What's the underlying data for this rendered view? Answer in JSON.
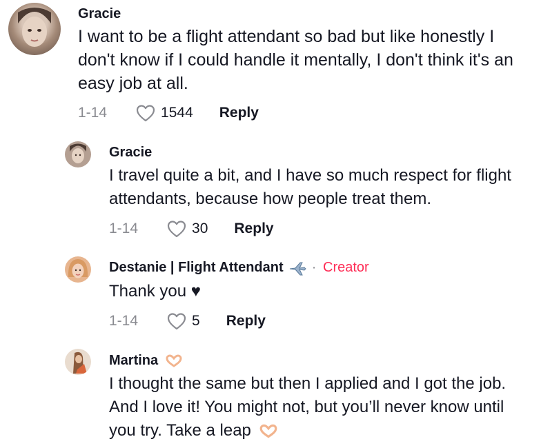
{
  "comments": [
    {
      "name": "Gracie",
      "text": "I want to be a flight attendant so bad but like honestly I don't know if I could handle it mentally, I don't think it's an easy job at all.",
      "date": "1-14",
      "likes": "1544",
      "reply": "Reply"
    },
    {
      "name": "Gracie",
      "text": "I travel quite a bit, and I have so much respect for flight attendants, because how people treat them.",
      "date": "1-14",
      "likes": "30",
      "reply": "Reply"
    },
    {
      "name": "Destanie | Flight Attendant",
      "separator": "·",
      "badge": "Creator",
      "text": "Thank you ♥",
      "date": "1-14",
      "likes": "5",
      "reply": "Reply"
    },
    {
      "name": "Martina",
      "text": "I thought the same but then I applied and I got the job. And I love it! You might not, but you’ll never know until you try. Take a leap",
      "date": "",
      "likes": "",
      "reply": ""
    }
  ],
  "colors": {
    "creator": "#fe2c55",
    "muted": "#8a8b91",
    "text": "#161823"
  },
  "icons": [
    "heart-outline-icon",
    "airplane-emoji-icon",
    "heart-hands-emoji-icon"
  ]
}
